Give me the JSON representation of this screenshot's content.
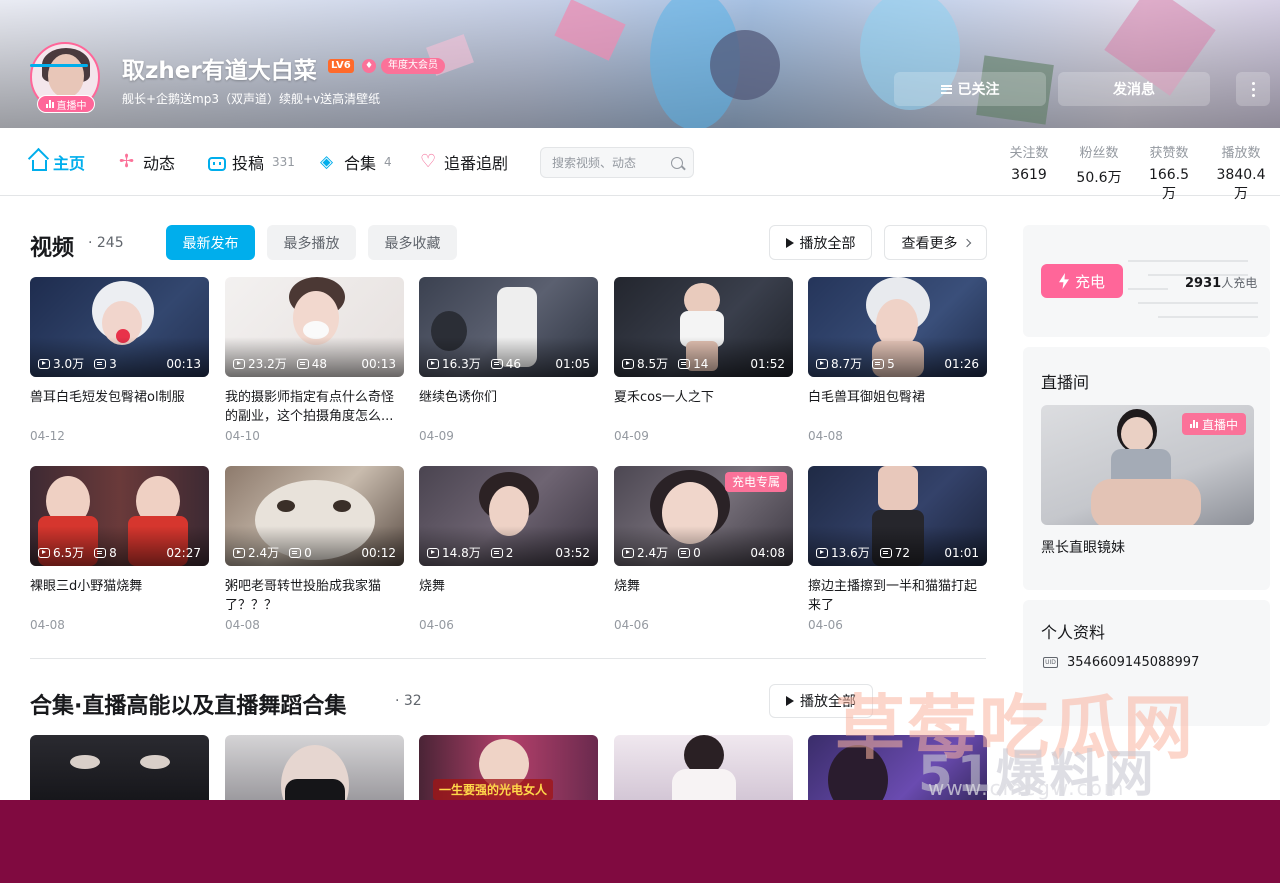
{
  "user": {
    "name": "取zher有道大白菜",
    "level": "LV6",
    "vip_label": "年度大会员",
    "live_status": "直播中",
    "signature": "舰长+企鹅送mp3（双声道）续舰+v送高清壁纸"
  },
  "actions": {
    "follow_label": "已关注",
    "message_label": "发消息"
  },
  "nav": {
    "tabs": [
      {
        "label": "主页",
        "count": ""
      },
      {
        "label": "动态",
        "count": ""
      },
      {
        "label": "投稿",
        "count": "331"
      },
      {
        "label": "合集",
        "count": "4"
      },
      {
        "label": "追番追剧",
        "count": ""
      }
    ],
    "search_placeholder": "搜索视频、动态"
  },
  "stats": [
    {
      "label": "关注数",
      "value": "3619"
    },
    {
      "label": "粉丝数",
      "value": "50.6万"
    },
    {
      "label": "获赞数",
      "value": "166.5万"
    },
    {
      "label": "播放数",
      "value": "3840.4万"
    }
  ],
  "videos_section": {
    "title": "视频",
    "count": "· 245",
    "sort_options": [
      "最新发布",
      "最多播放",
      "最多收藏"
    ],
    "play_all": "播放全部",
    "see_more": "查看更多",
    "items": [
      {
        "views": "3.0万",
        "danmaku": "3",
        "duration": "00:13",
        "title": "兽耳白毛短发包臀裙ol制服",
        "date": "04-12",
        "badge": ""
      },
      {
        "views": "23.2万",
        "danmaku": "48",
        "duration": "00:13",
        "title": "我的摄影师指定有点什么奇怪的副业，这个拍摄角度怎么...",
        "date": "04-10",
        "badge": ""
      },
      {
        "views": "16.3万",
        "danmaku": "46",
        "duration": "01:05",
        "title": "继续色诱你们",
        "date": "04-09",
        "badge": ""
      },
      {
        "views": "8.5万",
        "danmaku": "14",
        "duration": "01:52",
        "title": "夏禾cos一人之下",
        "date": "04-09",
        "badge": ""
      },
      {
        "views": "8.7万",
        "danmaku": "5",
        "duration": "01:26",
        "title": "白毛兽耳御姐包臀裙",
        "date": "04-08",
        "badge": ""
      },
      {
        "views": "6.5万",
        "danmaku": "8",
        "duration": "02:27",
        "title": "裸眼三d小野猫烧舞",
        "date": "04-08",
        "badge": ""
      },
      {
        "views": "2.4万",
        "danmaku": "0",
        "duration": "00:12",
        "title": "粥吧老哥转世投胎成我家猫了？？？",
        "date": "04-08",
        "badge": ""
      },
      {
        "views": "14.8万",
        "danmaku": "2",
        "duration": "03:52",
        "title": "烧舞",
        "date": "04-06",
        "badge": ""
      },
      {
        "views": "2.4万",
        "danmaku": "0",
        "duration": "04:08",
        "title": "烧舞",
        "date": "04-06",
        "badge": "充电专属"
      },
      {
        "views": "13.6万",
        "danmaku": "72",
        "duration": "01:01",
        "title": "擦边主播擦到一半和猫猫打起来了",
        "date": "04-06",
        "badge": ""
      }
    ]
  },
  "collection_section": {
    "title": "合集·直播高能以及直播舞蹈合集",
    "count": "· 32",
    "play_all": "播放全部",
    "thumb_caption": "一生要强的光电女人"
  },
  "charge": {
    "button_label": "充电",
    "count": "2931",
    "suffix": "人充电"
  },
  "live_room": {
    "heading": "直播间",
    "status": "直播中",
    "room_name": "黑长直眼镜妹"
  },
  "profile": {
    "heading": "个人资料",
    "uid_icon_text": "UID",
    "uid": "3546609145088997"
  },
  "watermark": {
    "line1": "草莓吃瓜网",
    "line2": "51爆料网",
    "line3": "www.cmcgw.com"
  },
  "colors": {
    "accent": "#00aeec",
    "pink": "#fb7299",
    "bottom_bar": "#800a40"
  }
}
